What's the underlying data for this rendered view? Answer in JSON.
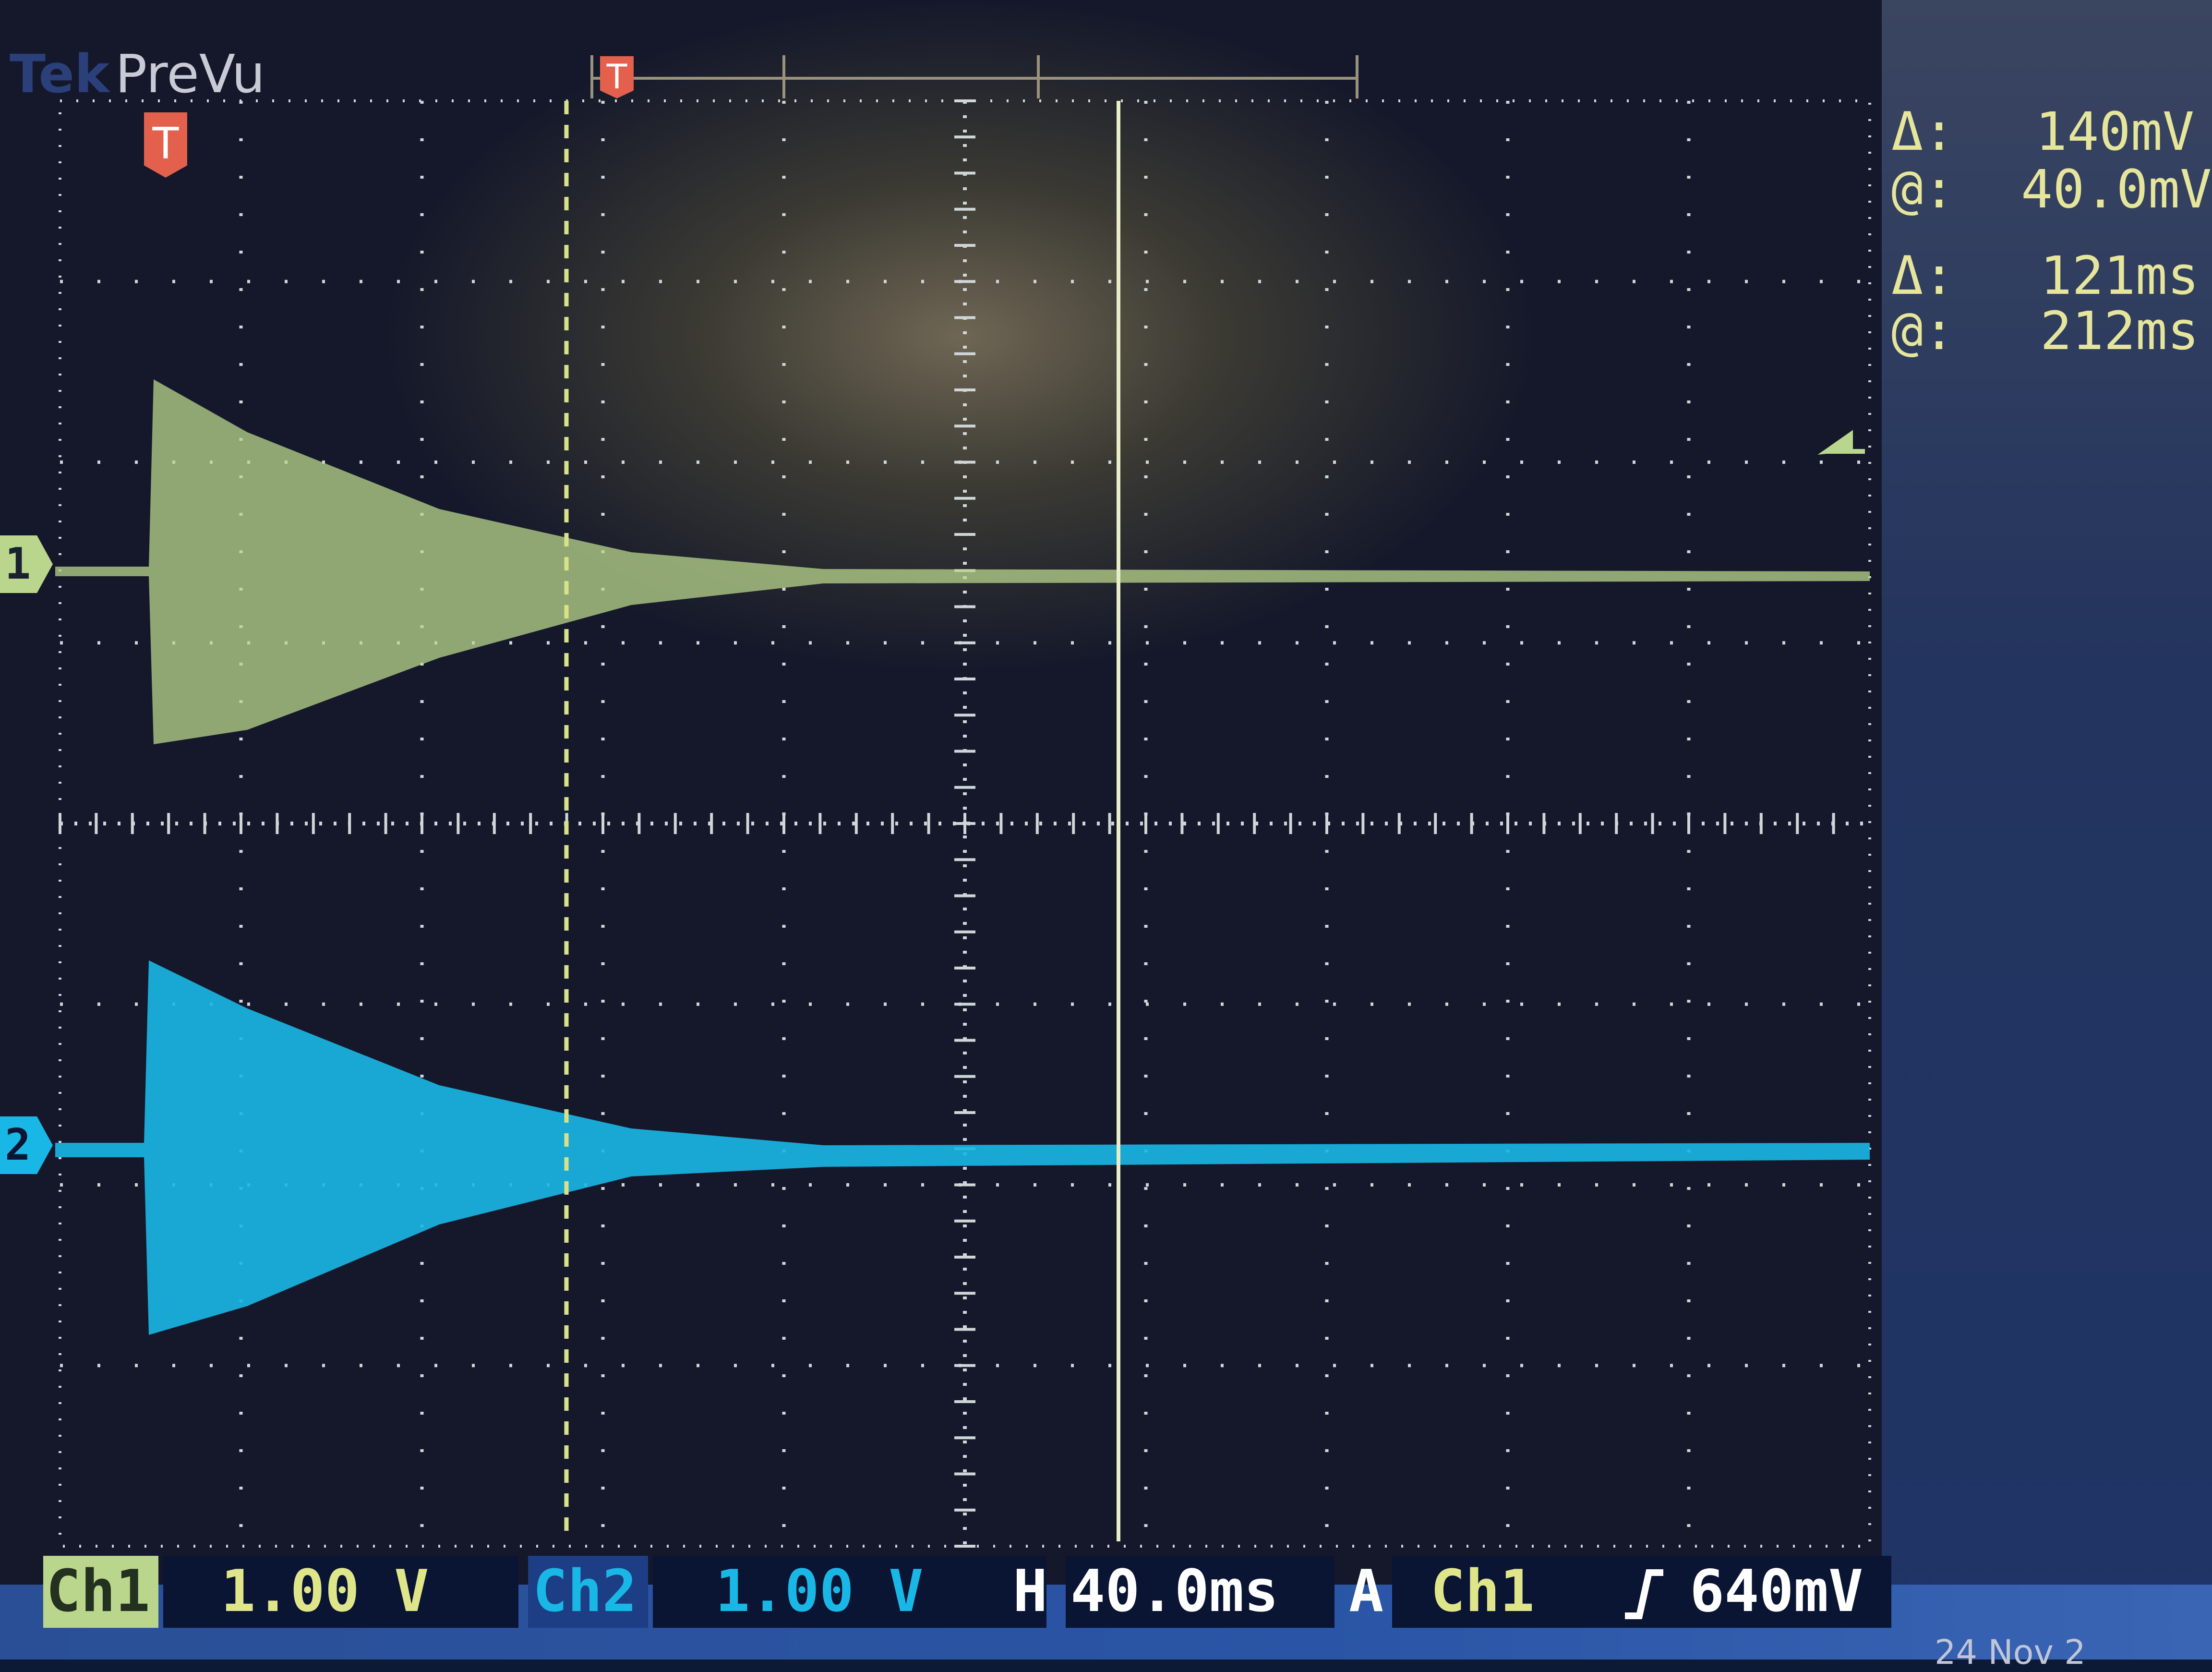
{
  "header": {
    "brand": "Tek",
    "mode": "PreVu",
    "record_trigger": "T"
  },
  "markers": {
    "trigger_position": "T",
    "ch1_ground": "1",
    "ch2_ground": "2"
  },
  "cursor_readouts": {
    "voltage": {
      "delta_label": "Δ:",
      "delta_value": "140mV",
      "at_label": "@:",
      "at_value": "40.0mV"
    },
    "time": {
      "delta_label": "Δ:",
      "delta_value": "121ms",
      "at_label": "@:",
      "at_value": "212ms"
    }
  },
  "status": {
    "ch1_label": "Ch1",
    "ch1_scale": "1.00 V",
    "ch2_label": "Ch2",
    "ch2_scale": "1.00 V",
    "horizontal_label": "H",
    "horizontal_scale": "40.0ms",
    "acquire_label": "A",
    "trigger_source": "Ch1",
    "trigger_slope_icon": "rising-edge-icon",
    "trigger_level": "640mV"
  },
  "date_fragment": "24 Nov 2",
  "colors": {
    "ch1": "#b9d68c",
    "ch2": "#19b7e6",
    "trigger": "#e2604c",
    "readout": "#e5e59b",
    "graticule": "#cfd6d8"
  }
}
